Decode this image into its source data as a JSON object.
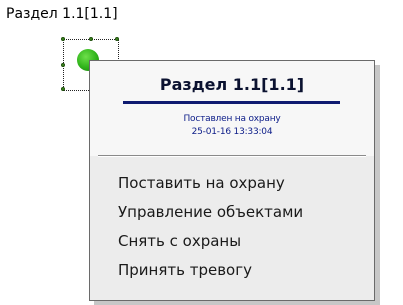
{
  "object": {
    "label": "Раздел 1.1[1.1]"
  },
  "popup": {
    "title": "Раздел 1.1[1.1]",
    "status_text": "Поставлен на охрану",
    "status_time": "25-01-16 13:33:04",
    "menu_items": [
      "Поставить на охрану",
      "Управление объектами",
      "Снять с охраны",
      "Принять тревогу"
    ]
  },
  "colors": {
    "status_indicator": "#2fb31a",
    "title_underline": "#0e1a70",
    "status_text": "#10208a"
  }
}
